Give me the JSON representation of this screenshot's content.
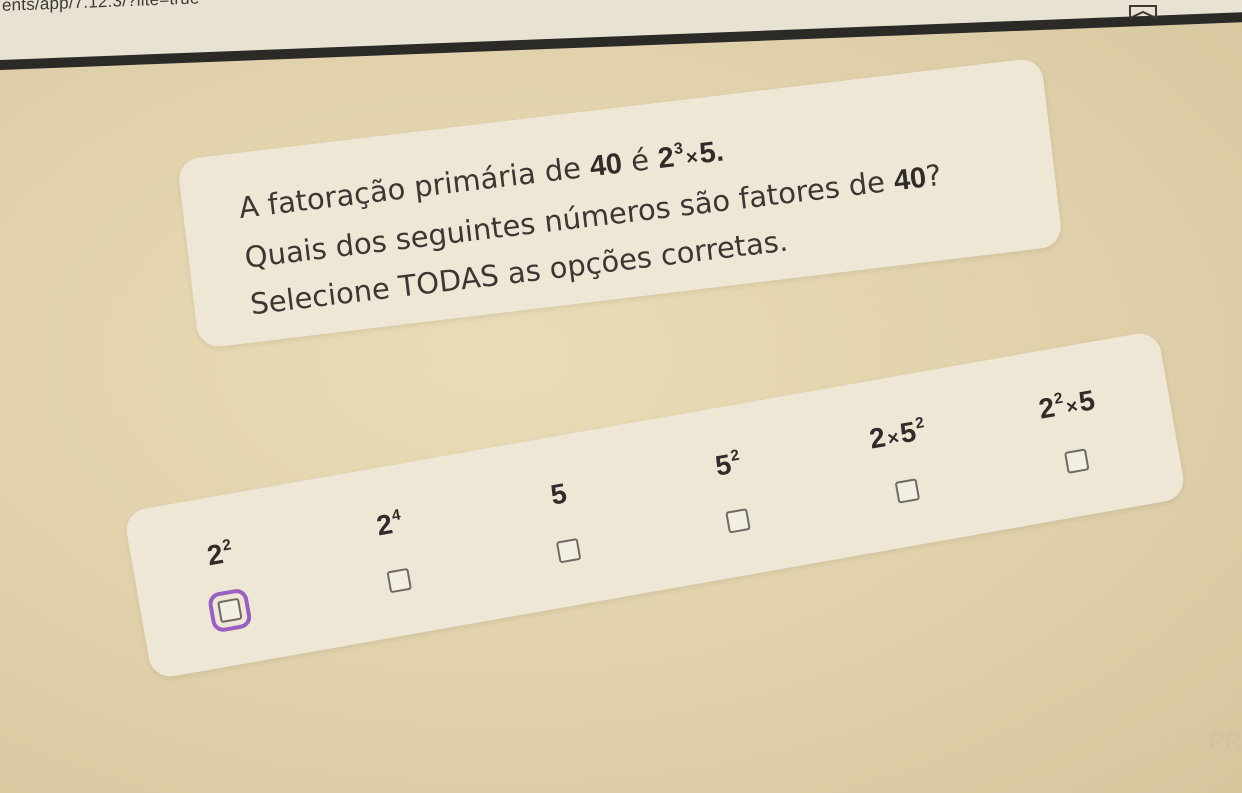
{
  "browser": {
    "url": "ents/app/7.12.3/?lite=true"
  },
  "question": {
    "line1_prefix": "A fatoração primária de ",
    "line1_num": "40",
    "line1_mid": " é ",
    "line1_base": "2",
    "line1_exp": "3",
    "line1_times": "×",
    "line1_factor": "5",
    "line1_end": ".",
    "line2_prefix": "Quais dos seguintes números são fatores de ",
    "line2_num": "40",
    "line2_end": "?",
    "line3": "Selecione TODAS as opções corretas."
  },
  "options": [
    {
      "base": "2",
      "exp": "2",
      "checked": false,
      "focused": true
    },
    {
      "base": "2",
      "exp": "4",
      "checked": false,
      "focused": false
    },
    {
      "base": "5",
      "exp": "",
      "checked": false,
      "focused": false
    },
    {
      "base": "5",
      "exp": "2",
      "checked": false,
      "focused": false
    },
    {
      "pre": "2",
      "times": "×",
      "base": "5",
      "exp": "2",
      "checked": false,
      "focused": false
    },
    {
      "base": "2",
      "exp": "2",
      "times": "×",
      "post": "5",
      "checked": false,
      "focused": false
    }
  ],
  "corner_text": "PR",
  "colors": {
    "focus_outline": "#9a5fc2",
    "card": "#eee7d6",
    "background": "#e2d3ad"
  }
}
